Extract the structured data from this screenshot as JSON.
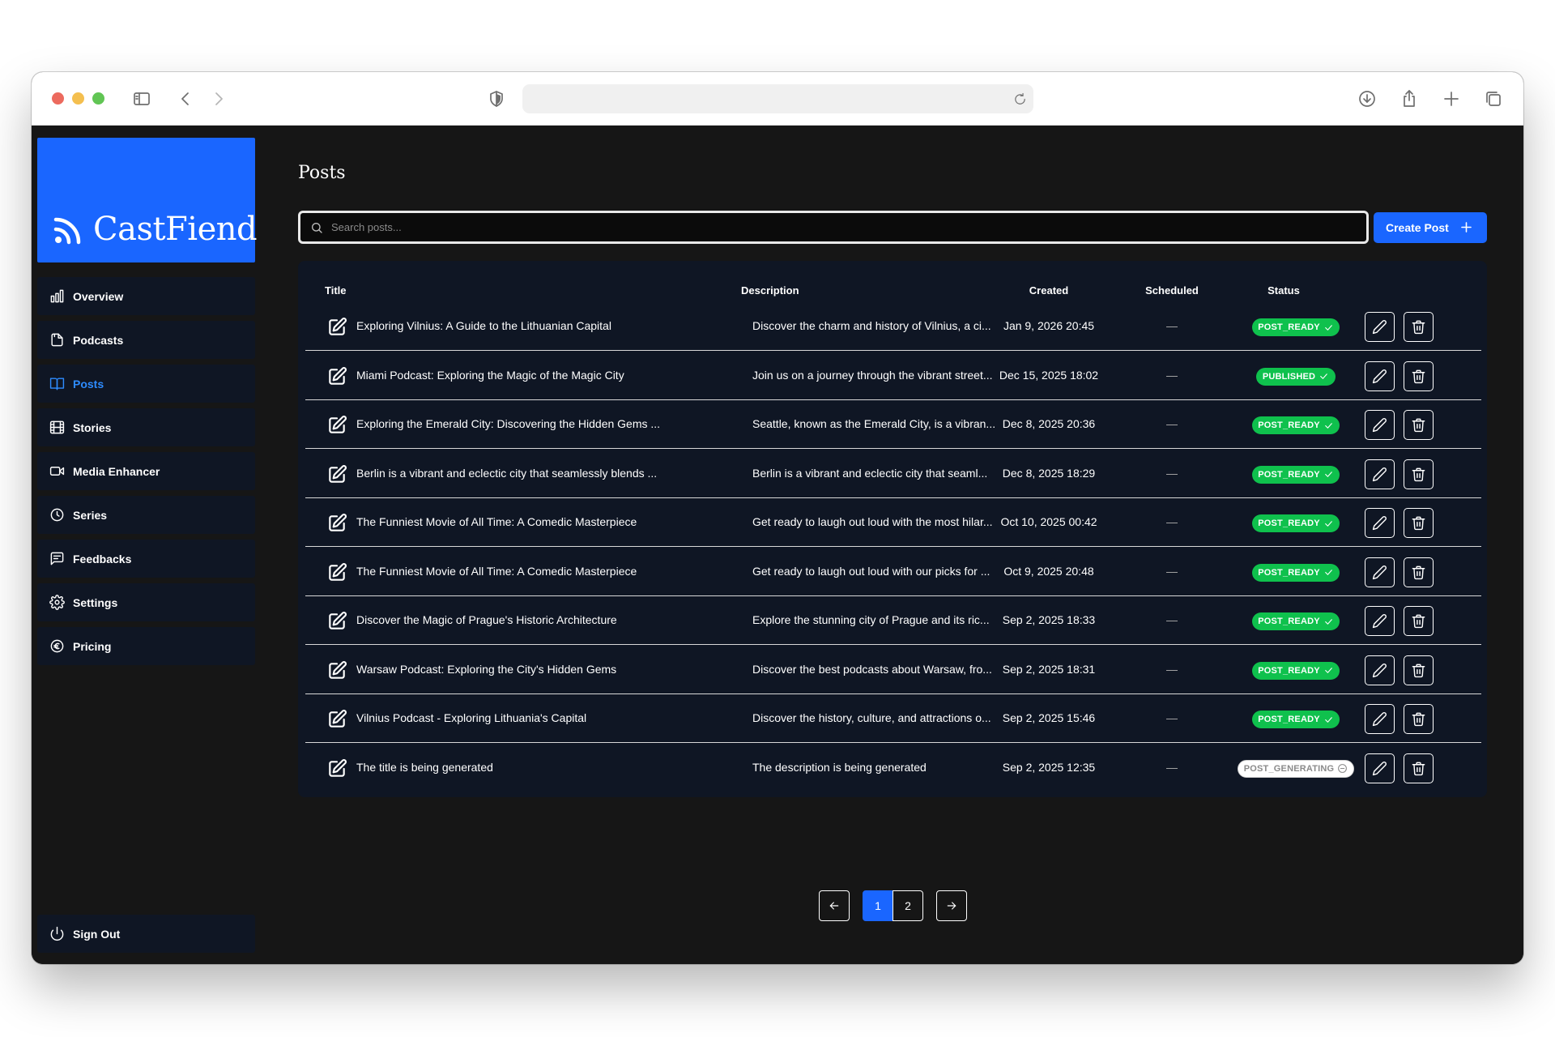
{
  "browser": {
    "url": "",
    "icons": [
      "sidebar-toggle-icon",
      "back-icon",
      "forward-icon",
      "shield-icon",
      "reload-icon",
      "download-icon",
      "share-icon",
      "new-tab-icon",
      "tabs-overview-icon"
    ]
  },
  "brand": {
    "name": "CastFiend",
    "icon": "rss-icon",
    "color": "#1a66ff"
  },
  "sidebar": {
    "items": [
      {
        "label": "Overview",
        "icon": "bar-chart-icon",
        "active": false
      },
      {
        "label": "Podcasts",
        "icon": "document-icon",
        "active": false
      },
      {
        "label": "Posts",
        "icon": "book-open-icon",
        "active": true
      },
      {
        "label": "Stories",
        "icon": "film-icon",
        "active": false
      },
      {
        "label": "Media Enhancer",
        "icon": "video-icon",
        "active": false
      },
      {
        "label": "Series",
        "icon": "clock-icon",
        "active": false
      },
      {
        "label": "Feedbacks",
        "icon": "message-icon",
        "active": false
      },
      {
        "label": "Settings",
        "icon": "gear-icon",
        "active": false
      },
      {
        "label": "Pricing",
        "icon": "euro-icon",
        "active": false
      }
    ],
    "sign_out": "Sign Out"
  },
  "main": {
    "title": "Posts",
    "search_placeholder": "Search posts...",
    "create_label": "Create Post",
    "columns": {
      "title": "Title",
      "description": "Description",
      "created": "Created",
      "scheduled": "Scheduled",
      "status": "Status"
    },
    "rows": [
      {
        "title": "Exploring Vilnius: A Guide to the Lithuanian Capital",
        "description": "Discover the charm and history of Vilnius, a ci...",
        "created": "Jan 9, 2026 20:45",
        "scheduled": "—",
        "status": "POST_READY"
      },
      {
        "title": "Miami Podcast: Exploring the Magic of the Magic City",
        "description": "Join us on a journey through the vibrant street...",
        "created": "Dec 15, 2025 18:02",
        "scheduled": "—",
        "status": "PUBLISHED"
      },
      {
        "title": "Exploring the Emerald City: Discovering the Hidden Gems ...",
        "description": "Seattle, known as the Emerald City, is a vibran...",
        "created": "Dec 8, 2025 20:36",
        "scheduled": "—",
        "status": "POST_READY"
      },
      {
        "title": "Berlin is a vibrant and eclectic city that seamlessly blends ...",
        "description": "Berlin is a vibrant and eclectic city that seaml...",
        "created": "Dec 8, 2025 18:29",
        "scheduled": "—",
        "status": "POST_READY"
      },
      {
        "title": "The Funniest Movie of All Time: A Comedic Masterpiece",
        "description": "Get ready to laugh out loud with the most hilar...",
        "created": "Oct 10, 2025 00:42",
        "scheduled": "—",
        "status": "POST_READY"
      },
      {
        "title": "The Funniest Movie of All Time: A Comedic Masterpiece",
        "description": "Get ready to laugh out loud with our picks for ...",
        "created": "Oct 9, 2025 20:48",
        "scheduled": "—",
        "status": "POST_READY"
      },
      {
        "title": "Discover the Magic of Prague's Historic Architecture",
        "description": "Explore the stunning city of Prague and its ric...",
        "created": "Sep 2, 2025 18:33",
        "scheduled": "—",
        "status": "POST_READY"
      },
      {
        "title": "Warsaw Podcast: Exploring the City's Hidden Gems",
        "description": "Discover the best podcasts about Warsaw, fro...",
        "created": "Sep 2, 2025 18:31",
        "scheduled": "—",
        "status": "POST_READY"
      },
      {
        "title": "Vilnius Podcast - Exploring Lithuania's Capital",
        "description": "Discover the history, culture, and attractions o...",
        "created": "Sep 2, 2025 15:46",
        "scheduled": "—",
        "status": "POST_READY"
      },
      {
        "title": "The title is being generated",
        "description": "The description is being generated",
        "created": "Sep 2, 2025 12:35",
        "scheduled": "—",
        "status": "POST_GENERATING"
      }
    ]
  },
  "pagination": {
    "pages": [
      "1",
      "2"
    ],
    "current": "1"
  },
  "colors": {
    "accent": "#1a66ff",
    "ready": "#0fc14d",
    "panel": "#0f1624",
    "background": "#161616"
  }
}
